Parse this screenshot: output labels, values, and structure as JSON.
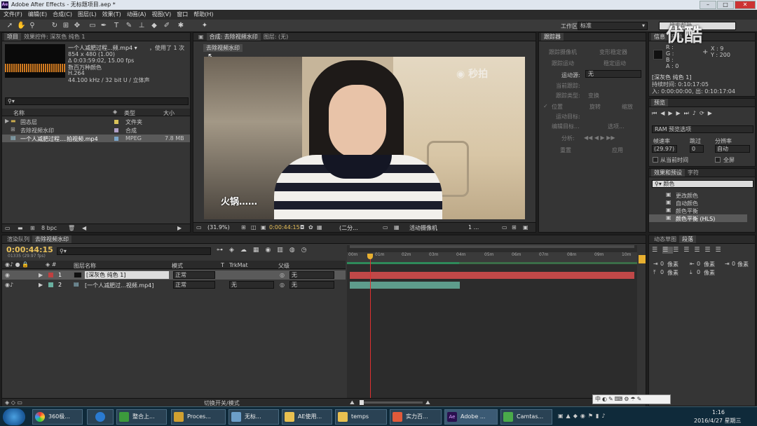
{
  "window": {
    "title": "Adobe After Effects - 无标题项目.aep *",
    "app_logo": "Ae"
  },
  "menu": [
    "文件(F)",
    "编辑(E)",
    "合成(C)",
    "图层(L)",
    "效果(T)",
    "动画(A)",
    "视图(V)",
    "窗口",
    "帮助(H)"
  ],
  "toolbar": {
    "workspace_label": "工作区:",
    "workspace_value": "标准",
    "search_placeholder": "搜索帮助"
  },
  "project_panel": {
    "tabs": [
      "项目",
      "效果控件: 深灰色 纯色 1"
    ],
    "footage_name": "一个人减肥过程...频.mp4 ▾",
    "footage_used": "，使用了 1 次",
    "footage_info": [
      "854 x 480 (1.00)",
      "Δ 0:03:59:02, 15.00 fps",
      "数百万种颜色",
      "H.264",
      "44.100 kHz / 32 bit U / 立体声"
    ],
    "columns": [
      "名称",
      "类型",
      "大小"
    ],
    "items": [
      {
        "name": "固态层",
        "type": "文件夹",
        "size": ""
      },
      {
        "name": "去除视频水印",
        "type": "合成",
        "size": ""
      },
      {
        "name": "一个人减肥过程....拍视频.mp4",
        "type": "MPEG",
        "size": "7.8 MB"
      }
    ],
    "bpc": "8 bpc"
  },
  "comp_panel": {
    "tab": "合成: 去除视频水印",
    "layer_tab": "图层: (无)",
    "comp_label": "去除视频水印",
    "subtitle": "火锅……",
    "watermark": "秒拍",
    "zoom": "(31.9%)",
    "timecode": "0:00:44:15",
    "resolution": "(二分...",
    "camera": "活动摄像机",
    "views": "1 ..."
  },
  "tracker_panel": {
    "tab": "跟踪器",
    "buttons": [
      "跟踪摄像机",
      "变形稳定器",
      "跟踪运动",
      "稳定运动"
    ],
    "motion_source_label": "运动源:",
    "motion_source_value": "无",
    "current_track": "当前跟踪:",
    "track_type": "跟踪类型:",
    "type_value": "变换",
    "checks": [
      "位置",
      "旋转",
      "缩放"
    ],
    "motion_target": "运动目标:",
    "edit_target": "编辑目标...",
    "options": "选项...",
    "analyze": "分析:",
    "reset": "重置",
    "apply": "应用"
  },
  "info_panel": {
    "tab": "信息",
    "tab2": "音频",
    "r": "R :",
    "g": "G :",
    "b": "B :",
    "a": "A : 0",
    "x": "X : 9",
    "y": "Y : 200",
    "layer_name": "[深灰色 纯色 1]",
    "duration": "持续时间: 0:10:17:05",
    "in_out": "入: 0:00:00:00, 出: 0:10:17:04"
  },
  "preview_panel": {
    "tab": "预览",
    "ram_options": "RAM 预览选项",
    "frame_rate_label": "帧速率",
    "skip_label": "跳过",
    "resolution_label": "分辨率",
    "frame_rate_value": "(29.97)",
    "skip_value": "0",
    "resolution_value": "自动",
    "from_current": "从当前时间",
    "fullscreen": "全屏"
  },
  "effects_panel": {
    "tabs": [
      "效果和预设",
      "字符"
    ],
    "search_value": "颜色",
    "items": [
      "更改颜色",
      "自动颜色",
      "颜色平衡",
      "颜色平衡 (HLS)"
    ]
  },
  "align_panel": {
    "tabs": [
      "动态草图",
      "段落"
    ],
    "pixel_unit": "像素",
    "values": [
      "0",
      "0",
      "0",
      "0",
      "0"
    ]
  },
  "timeline": {
    "tabs": [
      "渲染队列",
      "去除视频水印"
    ],
    "timecode": "0:00:44:15",
    "frame_info": "01335 (29.97 fps)",
    "columns": [
      "图层名称",
      "模式",
      "T",
      "TrkMat",
      "父级"
    ],
    "layers": [
      {
        "num": "1",
        "name": "[深灰色 纯色 1]",
        "mode": "正常",
        "trkmat": "",
        "parent": "无",
        "color": "#b03030"
      },
      {
        "num": "2",
        "name": "[一个人减肥过...视频.mp4]",
        "mode": "正常",
        "trkmat": "无",
        "parent": "无",
        "color": "#5aa08c"
      }
    ],
    "ruler": [
      "00m",
      "01m",
      "02m",
      "03m",
      "04m",
      "05m",
      "06m",
      "07m",
      "08m",
      "09m",
      "10m"
    ],
    "footer_toggle": "切换开关/模式"
  },
  "taskbar": {
    "items": [
      "360极...",
      "",
      "整合上...",
      "Proces...",
      "无标...",
      "AE使用...",
      "temps",
      "实力百...",
      "Adobe ...",
      "Camtas..."
    ],
    "time": "1:16",
    "date": "2016/4/27 星期三"
  },
  "overlay_logo": "优酷"
}
